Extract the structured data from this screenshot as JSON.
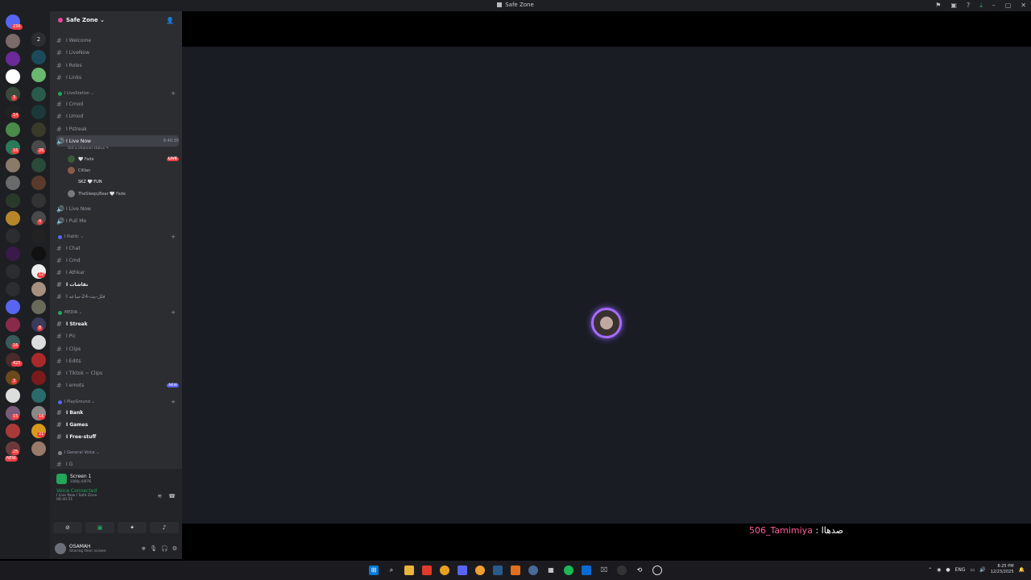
{
  "window": {
    "title": "Safe Zone"
  },
  "guild_badges": [
    "236",
    "2",
    "3",
    "14",
    "16",
    "26",
    "4",
    "12",
    "8",
    "16",
    "425",
    "3",
    "15",
    "16",
    "21",
    "25",
    "NEW"
  ],
  "server": {
    "name": "Safe Zone ⌄"
  },
  "channels_top": [
    {
      "name": "I Welcome"
    },
    {
      "name": "I LiveNow"
    },
    {
      "name": "I Roles"
    },
    {
      "name": "I Links"
    }
  ],
  "categories": {
    "livestation": "I LiveStation ⌄",
    "public": "I Public ⌄",
    "media": "MEDIA ⌄",
    "playground": "I PlayGround ⌄",
    "general_voice": "I General Voice ⌄"
  },
  "livestation_channels": [
    {
      "name": "I Cmod"
    },
    {
      "name": "I Umod"
    },
    {
      "name": "I Pstreak"
    }
  ],
  "active_voice": {
    "name": "I Live Now",
    "timer": "6:40:35",
    "status": "Set a channel status ✎",
    "members": [
      {
        "name": "🤍 Fade",
        "live": "LIVE"
      },
      {
        "name": "Cillian"
      },
      {
        "name": "SKZ 🤍 FUN"
      },
      {
        "name": "TheSleepyBear 🤍 Fade"
      }
    ]
  },
  "voice_after": [
    {
      "name": "I Live Now"
    },
    {
      "name": "I Pull Me"
    }
  ],
  "public_channels": [
    {
      "name": "I Chat"
    },
    {
      "name": "I Cmd"
    },
    {
      "name": "I Athkar"
    },
    {
      "name": "I نقاشات"
    },
    {
      "name": "I فلل-بث-24-ساعه"
    }
  ],
  "media_channels": [
    {
      "name": "I Streak",
      "bright": true
    },
    {
      "name": "I Pic"
    },
    {
      "name": "I Clips"
    },
    {
      "name": "I Edits"
    },
    {
      "name": "I Tiktok ~ Clips"
    },
    {
      "name": "I emots",
      "badge": "NEW"
    }
  ],
  "playground_channels": [
    {
      "name": "I Bank"
    },
    {
      "name": "I Games"
    },
    {
      "name": "I Free-stuff"
    }
  ],
  "general_voice_channels": [
    {
      "name": "I G"
    }
  ],
  "panel": {
    "screen_title": "Screen 1",
    "screen_sub": "1080p 60FPS",
    "voice_connected": "Voice Connected",
    "voice_location": "I Live Now / Safe Zone",
    "voice_timer": "06:40:51"
  },
  "user": {
    "name": "OSAMAH",
    "status": "Sharing their screen"
  },
  "caption": {
    "author": "506_Tamimiya",
    "text": ": صدهاا"
  },
  "taskbar": {
    "lang": "ENG",
    "time": "8:25 PM",
    "date": "12/23/2025"
  },
  "colors": {
    "accent": "#5865f2",
    "live": "#f23f43",
    "connected": "#23a55a",
    "ring": "#a66cff"
  }
}
